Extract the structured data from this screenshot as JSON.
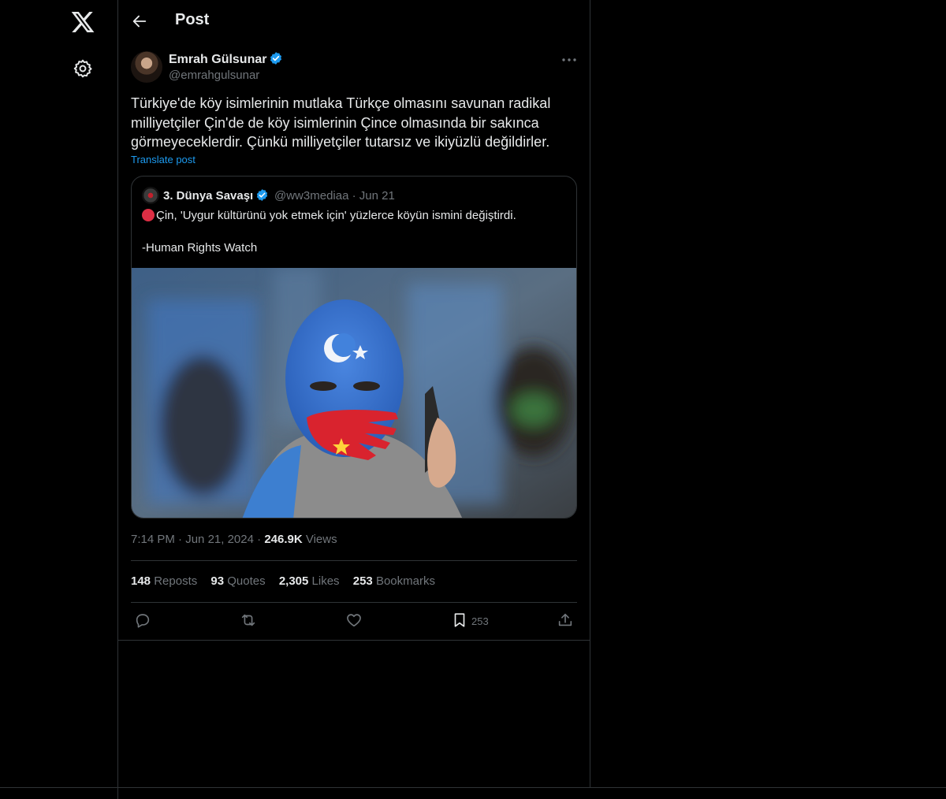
{
  "header": {
    "title": "Post"
  },
  "post": {
    "author": {
      "name": "Emrah Gülsunar",
      "handle": "@emrahgulsunar"
    },
    "text": "Türkiye'de köy isimlerinin mutlaka Türkçe olmasını savunan radikal milliyetçiler Çin'de de köy isimlerinin Çince olmasında bir sakınca görmeyeceklerdir. Çünkü milliyetçiler tutarsız ve ikiyüzlü değildirler.",
    "translate_label": "Translate post",
    "quote": {
      "name": "3. Dünya Savaşı",
      "handle": "@ww3mediaa",
      "date": "Jun 21",
      "line1": "Çin, 'Uygur kültürünü yok etmek için' yüzlerce köyün ismini değiştirdi.",
      "line2": "-Human Rights Watch"
    },
    "time": "7:14 PM",
    "date": "Jun 21, 2024",
    "views": "246.9K",
    "views_label": "Views",
    "stats": {
      "reposts": "148",
      "reposts_label": "Reposts",
      "quotes": "93",
      "quotes_label": "Quotes",
      "likes": "2,305",
      "likes_label": "Likes",
      "bookmarks": "253",
      "bookmarks_label": "Bookmarks"
    },
    "bookmark_count": "253"
  },
  "colors": {
    "accent": "#1d9bf0",
    "muted": "#71767b",
    "border": "#2f3336",
    "background": "#000000"
  }
}
